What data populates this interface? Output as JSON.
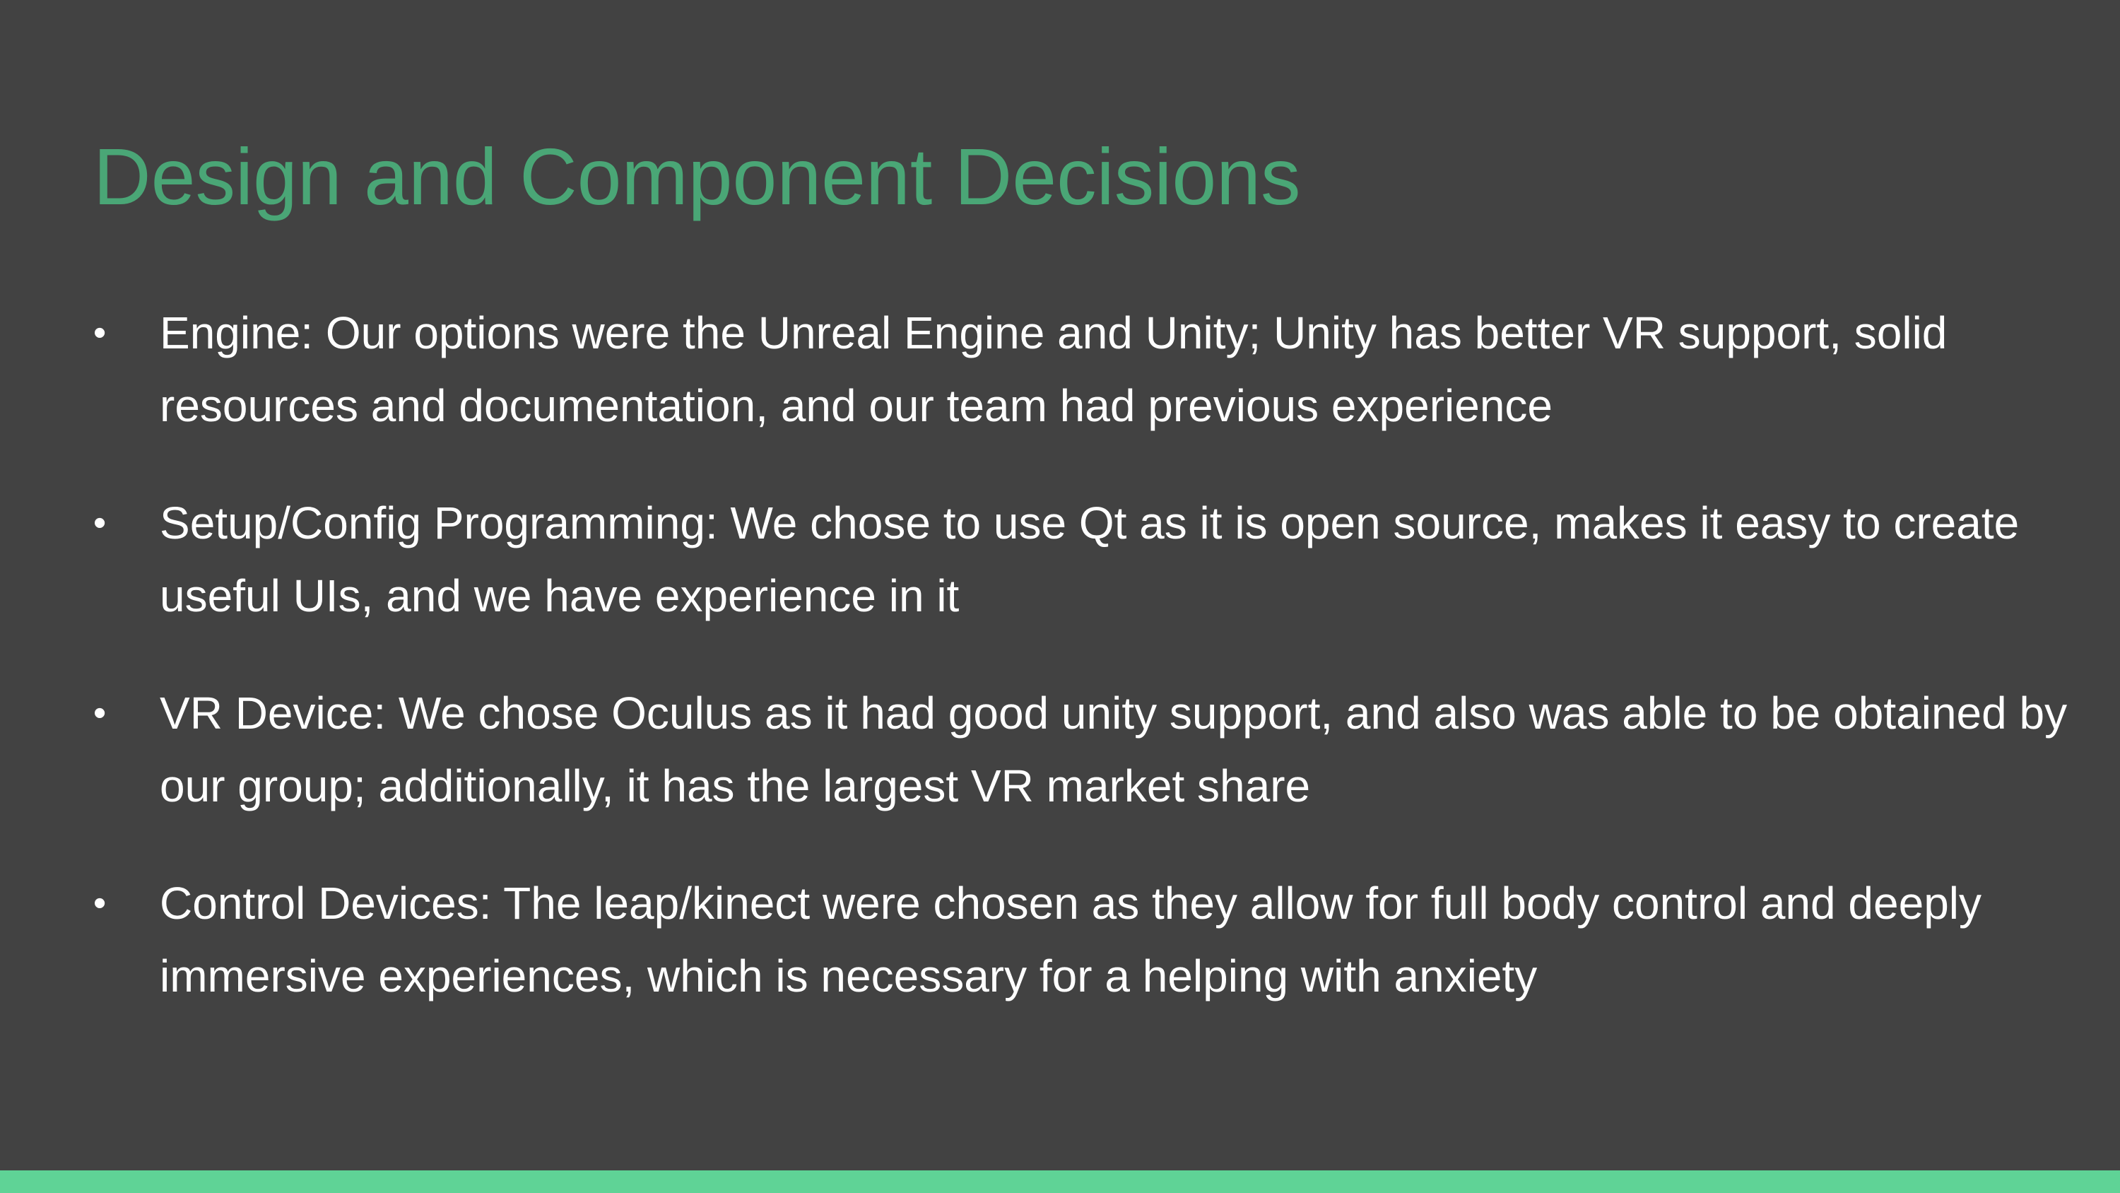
{
  "slide": {
    "title": "Design and Component Decisions",
    "bullet_glyph": "•",
    "bullets": [
      "Engine: Our options were the Unreal Engine and Unity; Unity has better VR support, solid resources and documentation, and our team had previous experience",
      "Setup/Config Programming: We chose to use Qt as it is open source, makes it easy to create useful UIs, and we have experience in it",
      "VR Device: We chose Oculus as it had good unity support, and also was able to be obtained by our group; additionally, it has the largest VR market share",
      "Control Devices: The leap/kinect were chosen as they allow for full body control and deeply immersive experiences, which is necessary for a helping with anxiety"
    ]
  },
  "colors": {
    "background": "#424242",
    "title": "#4aa676",
    "text": "#ffffff",
    "accent_bar": "#5fd396"
  }
}
